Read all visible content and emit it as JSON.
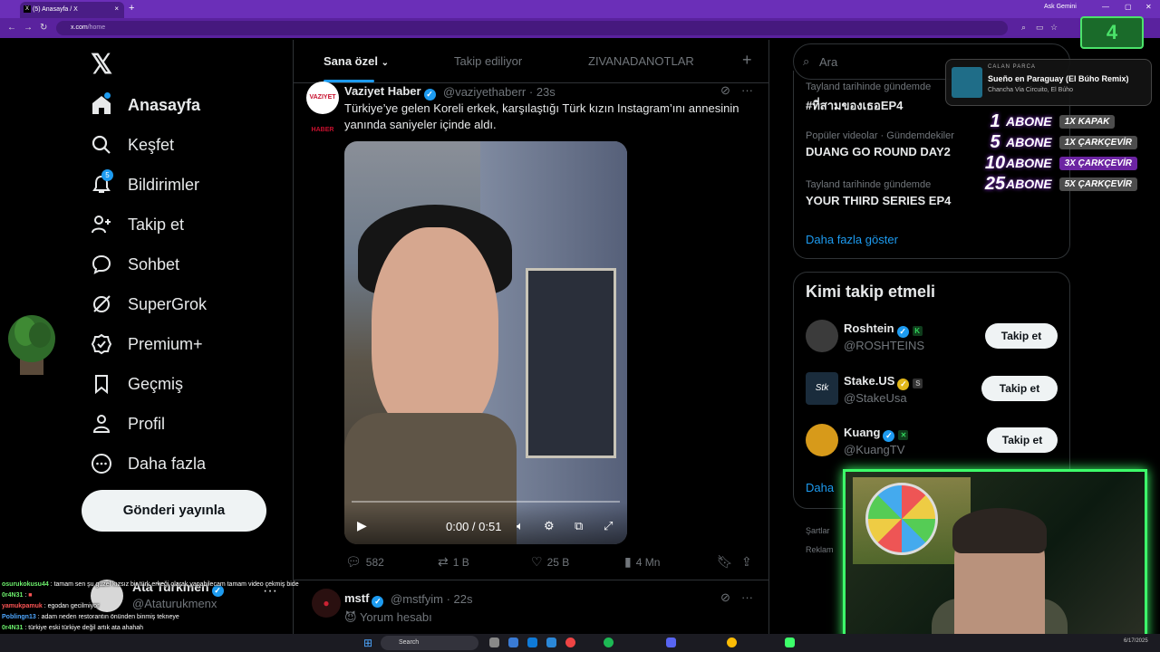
{
  "browser": {
    "tab_title": "(5) Anasayfa / X",
    "tab_close": "×",
    "new_tab": "+",
    "gemini": "Ask Gemini",
    "url_host": "x.com",
    "url_path": "/home"
  },
  "stream_counter": "4",
  "nav": {
    "logo": "𝕏",
    "items": [
      {
        "label": "Anasayfa"
      },
      {
        "label": "Keşfet"
      },
      {
        "label": "Bildirimler",
        "badge": "5"
      },
      {
        "label": "Takip et"
      },
      {
        "label": "Sohbet"
      },
      {
        "label": "SuperGrok"
      },
      {
        "label": "Premium+"
      },
      {
        "label": "Geçmiş"
      },
      {
        "label": "Profil"
      },
      {
        "label": "Daha fazla"
      }
    ],
    "post_button": "Gönderi yayınla",
    "account": {
      "name": "Ata Turkmen",
      "handle": "@Ataturukmenx",
      "more": "···"
    }
  },
  "timeline": {
    "tabs": [
      "Sana özel",
      "Takip ediliyor",
      "ZIVANADANOTLAR"
    ],
    "add_tab": "+",
    "tweet1": {
      "avatar_text": "VAZIYET HABER",
      "name": "Vaziyet Haber",
      "handle": "@vaziyethaberr",
      "time": "· 23s",
      "text": "Türkiye’ye gelen Koreli erkek, karşılaştığı Türk kızın Instagram’ını annesinin yanında saniyeler içinde aldı.",
      "video_time": "0:00 / 0:51",
      "replies": "582",
      "reposts": "1 B",
      "likes": "25 B",
      "views": "4 Mn"
    },
    "tweet2": {
      "name": "mstf",
      "handle": "@mstfyim",
      "time": "· 22s",
      "text": "Yorum hesabı"
    }
  },
  "right": {
    "search_placeholder": "Ara",
    "trends": [
      {
        "category": "Tayland tarihinde gündemde",
        "title": "#ที่สามของเธอEP4"
      },
      {
        "category": "Popüler videolar · Gündemdekiler",
        "title": "DUANG GO ROUND DAY2"
      },
      {
        "category": "Tayland tarihinde gündemde",
        "title": "YOUR THIRD SERIES EP4"
      }
    ],
    "show_more": "Daha fazla göster",
    "who_to_follow": "Kimi takip etmeli",
    "suggestions": [
      {
        "name": "Roshtein",
        "handle": "@ROSHTEINS",
        "button": "Takip et"
      },
      {
        "name": "Stake.US",
        "handle": "@StakeUsa",
        "button": "Takip et"
      },
      {
        "name": "Kuang",
        "handle": "@KuangTV",
        "button": "Takip et"
      }
    ],
    "show_more_partial": "Daha",
    "footer": [
      "Şartlar",
      "Reklam"
    ]
  },
  "overlay": {
    "now_playing_label": "CALAN PARCA",
    "song": "Sueño en Paraguay (El Búho Remix)",
    "artist": "Chancha Via Circuito, El Búho",
    "abone": [
      {
        "num": "1",
        "label": "ABONE",
        "reward": "1X KAPAK"
      },
      {
        "num": "5",
        "label": "ABONE",
        "reward": "1X ÇARKÇEVİR"
      },
      {
        "num": "10",
        "label": "ABONE",
        "reward": "3X ÇARKÇEVİR"
      },
      {
        "num": "25",
        "label": "ABONE",
        "reward": "5X ÇARKÇEVİR"
      }
    ],
    "chat": [
      {
        "user": "osurukokusu44",
        "msg": ": tamam sen şu güzel kızsız bir türk erkeği olarak yapabilecam tamam video çekmiş bide"
      },
      {
        "user": "0r4N31",
        "msg": ":"
      },
      {
        "user": "yamukpamuk",
        "msg": ": egodan gecilmiyor"
      },
      {
        "user": "Poblingn13",
        "msg": ": adam neden restorantın önünden binmiş tekneye"
      },
      {
        "user": "0r4N31",
        "msg": ": türkiye eski türkiye değil artık ata ahahah"
      }
    ]
  },
  "taskbar": {
    "search": "Search",
    "clock": "6/17/2025"
  }
}
